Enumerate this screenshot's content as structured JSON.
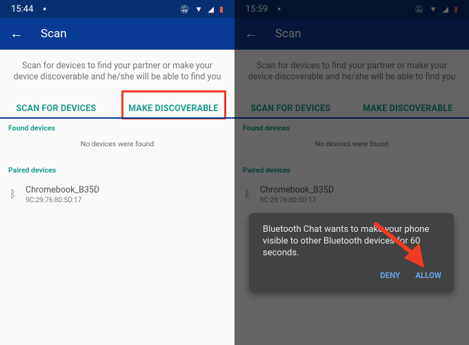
{
  "left": {
    "time": "15:44",
    "title": "Scan",
    "intro": "Scan for devices to find your partner or make your device discoverable and he/she will be able to find you",
    "scan_button": "SCAN FOR DEVICES",
    "discover_button": "MAKE DISCOVERABLE",
    "found_header": "Found devices",
    "no_devices": "No devices were found",
    "paired_header": "Paired devices",
    "device_name": "Chromebook_B35D",
    "device_address": "9C:29:76:80:5D:17"
  },
  "right": {
    "time": "15:59",
    "title": "Scan",
    "intro": "Scan for devices to find your partner or make your device discoverable and he/she will be able to find you",
    "scan_button": "SCAN FOR DEVICES",
    "discover_button": "MAKE DISCOVERABLE",
    "found_header": "Found devices",
    "no_devices": "No devices were found",
    "paired_header": "Paired devices",
    "device_name": "Chromebook_B35D",
    "device_address": "9C:29:76:80:5D:17",
    "dialog": {
      "message": "Bluetooth Chat wants to make your phone visible to other Bluetooth devices for 60 seconds.",
      "deny": "DENY",
      "allow": "ALLOW"
    }
  },
  "icons": {
    "back": "arrow-left-icon",
    "bluetooth": "bluetooth-icon",
    "status": [
      "notification-icon",
      "mute-icon",
      "wifi-icon",
      "signal-icon",
      "battery-icon"
    ]
  },
  "colors": {
    "appbar": "#0a3b94",
    "statusbar": "#082f72",
    "accent": "#1a9c8c",
    "highlight": "#f33a22",
    "dialog_button": "#6aa6e8"
  }
}
